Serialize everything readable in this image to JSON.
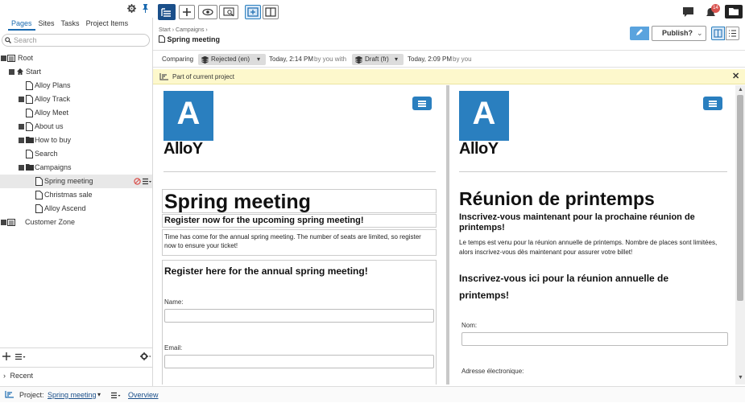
{
  "left_tabs": [
    "Pages",
    "Sites",
    "Tasks",
    "Project Items"
  ],
  "search_placeholder": "Search",
  "tree": {
    "root": "Root",
    "start": "Start",
    "alloy_plans": "Alloy Plans",
    "alloy_track": "Alloy Track",
    "alloy_meet": "Alloy Meet",
    "about_us": "About us",
    "how_to_buy": "How to buy",
    "search": "Search",
    "campaigns": "Campaigns",
    "spring_meeting": "Spring meeting",
    "christmas_sale": "Christmas sale",
    "alloy_ascend": "Alloy Ascend",
    "customer_zone": "Customer Zone"
  },
  "recent_label": "Recent",
  "bottom": {
    "project_label": "Project:",
    "project_name": "Spring meeting",
    "overview": "Overview"
  },
  "breadcrumb": {
    "start": "Start",
    "campaigns": "Campaigns"
  },
  "page_title": "Spring meeting",
  "publish_label": "Publish?",
  "notification_count": "14",
  "compare": {
    "label": "Comparing",
    "left_version": "Rejected (en)",
    "left_time": "Today, 2:14 PM",
    "left_by": "by you with",
    "right_version": "Draft (fr)",
    "right_time": "Today, 2:09 PM",
    "right_by": "by you"
  },
  "notice_text": "Part of current project",
  "preview_en": {
    "logo_letter": "A",
    "brand": "AlloY",
    "heading": "Spring meeting",
    "subheading": "Register now for the upcoming spring meeting!",
    "body": "Time has come for the annual spring meeting. The number of seats are limited, so register now to ensure your ticket!",
    "form_title": "Register here for the annual spring meeting!",
    "name_label": "Name:",
    "email_label": "Email:"
  },
  "preview_fr": {
    "logo_letter": "A",
    "brand": "AlloY",
    "heading": "Réunion de printemps",
    "subheading": "Inscrivez-vous maintenant pour la prochaine réunion de printemps!",
    "body": "Le temps est venu pour la réunion annuelle de printemps. Nombre de places sont limitées, alors inscrivez-vous dès maintenant pour assurer votre billet!",
    "form_title": "Inscrivez-vous ici pour la réunion annuelle de printemps!",
    "name_label": "Nom:",
    "email_label": "Adresse électronique:"
  },
  "colors": {
    "accent": "#1a6ab0",
    "brand_blue": "#2a7fbf",
    "notice_bg": "#fdf8cc",
    "danger": "#d9534f"
  }
}
